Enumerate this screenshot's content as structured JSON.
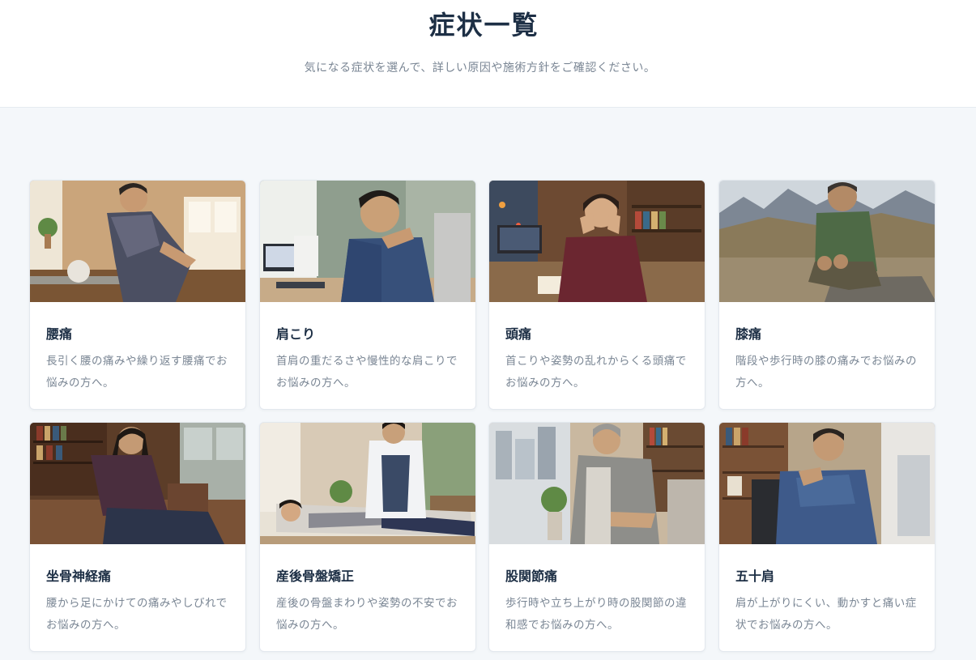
{
  "header": {
    "title": "症状一覧",
    "subtitle": "気になる症状を選んで、詳しい原因や施術方針をご確認ください。"
  },
  "cards": [
    {
      "title": "腰痛",
      "desc": "長引く腰の痛みや繰り返す腰痛でお悩みの方へ。"
    },
    {
      "title": "肩こり",
      "desc": "首肩の重だるさや慢性的な肩こりでお悩みの方へ。"
    },
    {
      "title": "頭痛",
      "desc": "首こりや姿勢の乱れからくる頭痛でお悩みの方へ。"
    },
    {
      "title": "膝痛",
      "desc": "階段や歩行時の膝の痛みでお悩みの方へ。"
    },
    {
      "title": "坐骨神経痛",
      "desc": "腰から足にかけての痛みやしびれでお悩みの方へ。"
    },
    {
      "title": "産後骨盤矯正",
      "desc": "産後の骨盤まわりや姿勢の不安でお悩みの方へ。"
    },
    {
      "title": "股関節痛",
      "desc": "歩行時や立ち上がり時の股関節の違和感でお悩みの方へ。"
    },
    {
      "title": "五十肩",
      "desc": "肩が上がりにくい、動かすと痛い症状でお悩みの方へ。"
    }
  ]
}
